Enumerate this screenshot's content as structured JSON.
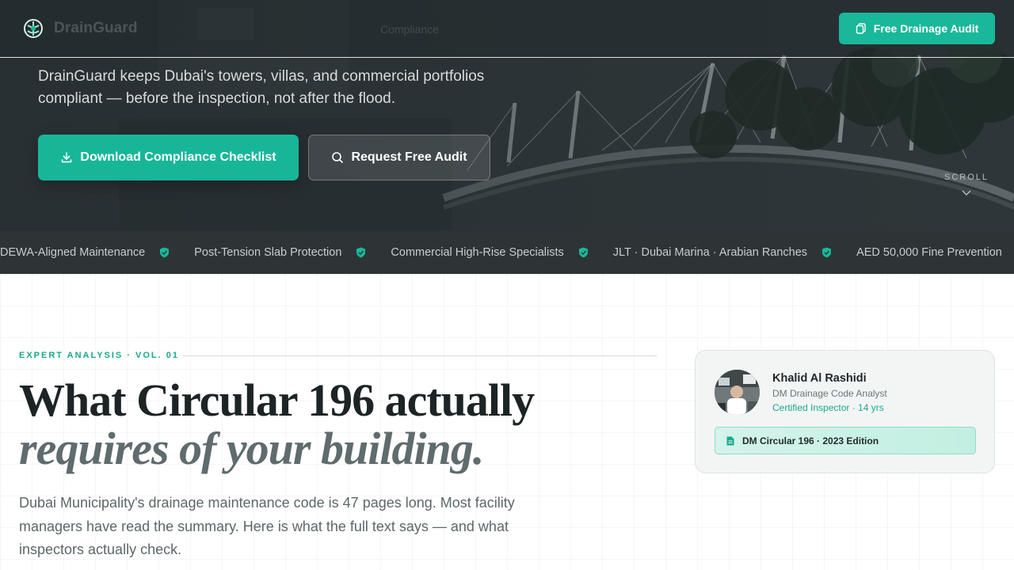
{
  "nav": {
    "brand": "DrainGuard",
    "center_link": "Compliance",
    "cta_label": "Free Drainage Audit"
  },
  "hero": {
    "subtitle": "DrainGuard keeps Dubai's towers, villas, and commercial portfolios compliant — before the inspection, not after the flood.",
    "primary_button": "Download Compliance Checklist",
    "secondary_button": "Request Free Audit",
    "scroll_label": "SCROLL"
  },
  "ticker": {
    "items": [
      "DEWA-Aligned Maintenance",
      "Post-Tension Slab Protection",
      "Commercial High-Rise Specialists",
      "JLT · Dubai Marina · Arabian Ranches",
      "AED 50,000 Fine Prevention"
    ]
  },
  "article": {
    "eyebrow": "EXPERT ANALYSIS · VOL. 01",
    "headline_line1": "What Circular 196 actually",
    "headline_line2": "requires of your building.",
    "lede": "Dubai Municipality's drainage maintenance code is 47 pages long. Most facility managers have read the summary. Here is what the full text says — and what inspectors actually check."
  },
  "author": {
    "name": "Khalid Al Rashidi",
    "role": "DM Drainage Code Analyst",
    "credential": "Certified Inspector · 14 yrs",
    "document": "DM Circular 196 · 2023 Edition"
  },
  "colors": {
    "accent": "#19b89a",
    "hero_bg": "#2c3437",
    "ticker_bg": "#2e3436"
  }
}
